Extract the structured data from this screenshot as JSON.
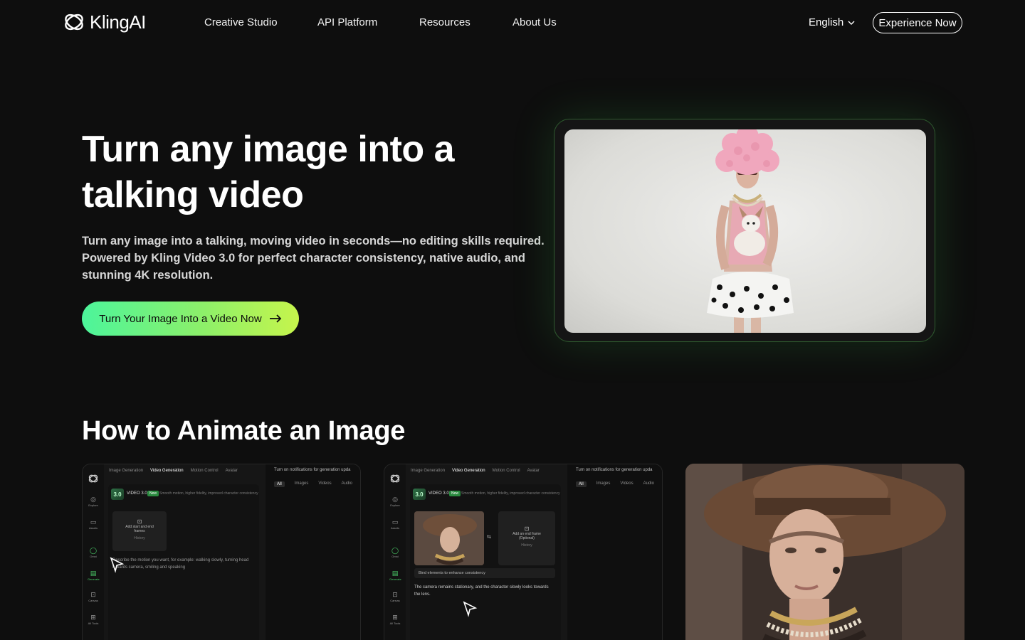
{
  "nav": {
    "brand": "KlingAI",
    "links": [
      "Creative Studio",
      "API Platform",
      "Resources",
      "About Us"
    ],
    "language": "English",
    "cta": "Experience Now"
  },
  "hero": {
    "title": "Turn any image into a talking video",
    "description": "Turn any image into a talking, moving video in seconds—no editing skills required. Powered by Kling Video 3.0 for perfect character consistency, native audio, and stunning 4K resolution.",
    "cta": "Turn Your Image Into a Video Now"
  },
  "how": {
    "title": "How to Animate an Image",
    "ui": {
      "tabs": [
        "Image Generation",
        "Video Generation",
        "Motion Control",
        "Avatar"
      ],
      "notify": "Turn on notifications for generation upda",
      "right_tabs": [
        "All",
        "Images",
        "Videos",
        "Audio"
      ],
      "sidebar": [
        "Explore",
        "Assets",
        "Omni",
        "Generate",
        "Canvas",
        "All Tools"
      ],
      "model_badge": "3.0",
      "model_name": "VIDEO 3.0",
      "new_tag": "New",
      "model_sub": "Smooth motion, higher fidelity, improved character consistency",
      "upload_label": "Add start and end frames",
      "upload_hint": "History",
      "prompt_placeholder": "Describe the motion you want, for example: walking slowly, turning head towards camera, smiling and speaking",
      "swap_label": "Add an end frame (Optional)",
      "card2_instruction": "Bind elements to enhance consistency",
      "card2_prompt": "The camera remains stationary, and the character slowly looks towards the lens."
    }
  },
  "colors": {
    "background": "#0e0e0e",
    "cta_start": "#4cf59b",
    "cta_end": "#c6f54c",
    "frame_glow": "#2f5a2f"
  }
}
